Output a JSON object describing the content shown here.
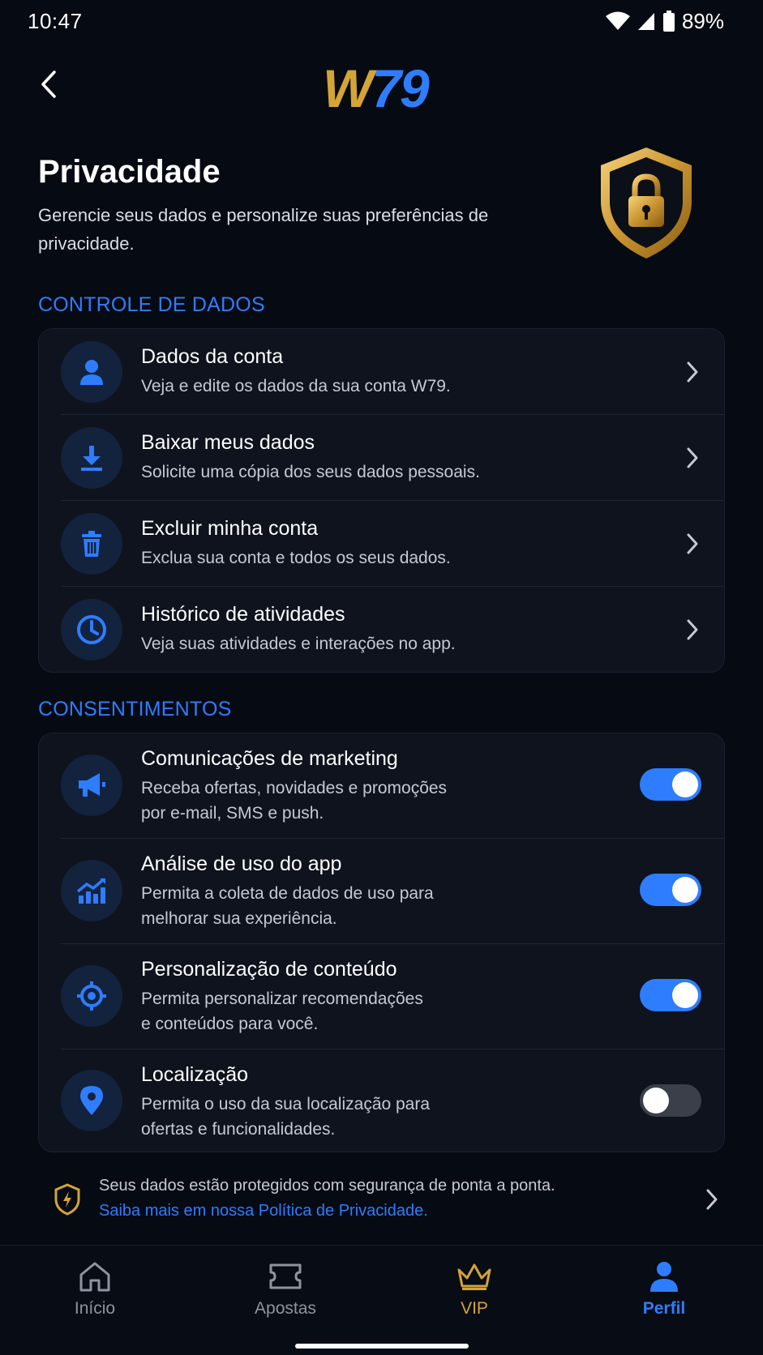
{
  "status_bar": {
    "time": "10:47",
    "battery": "89%"
  },
  "header": {
    "logo_w": "W",
    "logo_num": "79"
  },
  "page": {
    "title": "Privacidade",
    "subtitle": "Gerencie seus dados e personalize suas preferências de privacidade."
  },
  "data_control": {
    "label": "CONTROLE DE DADOS",
    "items": [
      {
        "title": "Dados da conta",
        "desc": "Veja e edite os dados da sua conta W79.",
        "icon": "user-icon"
      },
      {
        "title": "Baixar meus dados",
        "desc": "Solicite uma cópia dos seus dados pessoais.",
        "icon": "download-icon"
      },
      {
        "title": "Excluir minha conta",
        "desc": "Exclua sua conta e todos os seus dados.",
        "icon": "trash-icon"
      },
      {
        "title": "Histórico de atividades",
        "desc": "Veja suas atividades e interações no app.",
        "icon": "clock-icon"
      }
    ]
  },
  "consents": {
    "label": "CONSENTIMENTOS",
    "items": [
      {
        "title": "Comunicações de marketing",
        "desc1": "Receba ofertas, novidades e promoções",
        "desc2": "por e-mail, SMS e push.",
        "enabled": true,
        "icon": "megaphone-icon"
      },
      {
        "title": "Análise de uso do app",
        "desc1": "Permita a coleta de dados de uso para",
        "desc2": "melhorar sua experiência.",
        "enabled": true,
        "icon": "chart-icon"
      },
      {
        "title": "Personalização de conteúdo",
        "desc1": "Permita personalizar recomendações",
        "desc2": "e conteúdos para você.",
        "enabled": true,
        "icon": "target-icon"
      },
      {
        "title": "Localização",
        "desc1": "Permita o uso da sua localização para",
        "desc2": "ofertas e funcionalidades.",
        "enabled": false,
        "icon": "location-pin-icon"
      }
    ]
  },
  "footer": {
    "text": "Seus dados estão protegidos com segurança de ponta a ponta.",
    "link": "Saiba mais em nossa Política de Privacidade."
  },
  "nav": {
    "items": [
      {
        "label": "Início",
        "icon": "home-icon"
      },
      {
        "label": "Apostas",
        "icon": "ticket-icon"
      },
      {
        "label": "VIP",
        "icon": "crown-icon"
      },
      {
        "label": "Perfil",
        "icon": "user-icon",
        "active": true
      }
    ]
  },
  "colors": {
    "accent": "#2e7dff",
    "gold": "#d4a437",
    "background": "#060a12",
    "card": "#0e131d"
  }
}
